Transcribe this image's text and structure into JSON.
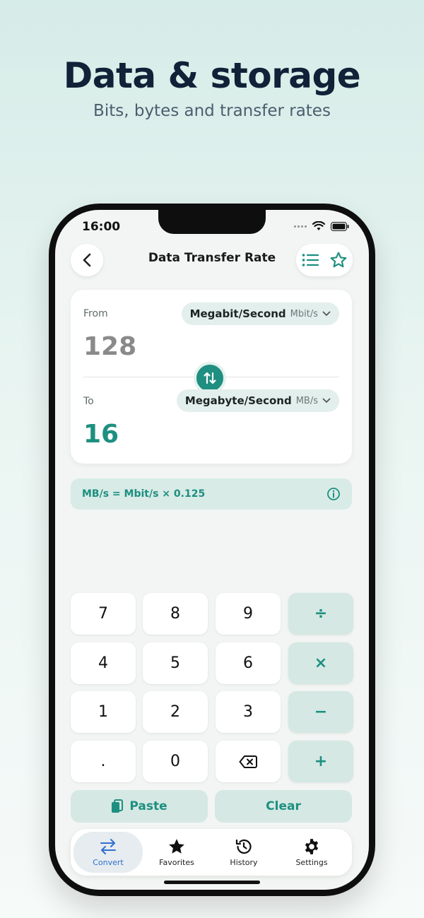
{
  "headline": "Data & storage",
  "subheadline": "Bits, bytes and transfer rates",
  "status": {
    "time": "16:00"
  },
  "nav": {
    "title": "Data Transfer Rate",
    "back_icon": "chevron-left-icon",
    "list_icon": "list-icon",
    "favorite_icon": "star-outline-icon"
  },
  "converter": {
    "from_label": "From",
    "from_unit": "Megabit/Second",
    "from_abbr": "Mbit/s",
    "from_value": "128",
    "to_label": "To",
    "to_unit": "Megabyte/Second",
    "to_abbr": "MB/s",
    "to_value": "16"
  },
  "formula": "MB/s = Mbit/s × 0.125",
  "keypad": {
    "rows": [
      [
        "7",
        "8",
        "9",
        "÷"
      ],
      [
        "4",
        "5",
        "6",
        "×"
      ],
      [
        "1",
        "2",
        "3",
        "−"
      ],
      [
        ".",
        "0",
        "⌫",
        "+"
      ]
    ],
    "paste": "Paste",
    "clear": "Clear"
  },
  "tabs": [
    {
      "label": "Convert",
      "icon": "swap-arrows-icon",
      "active": true
    },
    {
      "label": "Favorites",
      "icon": "star-icon"
    },
    {
      "label": "History",
      "icon": "history-icon"
    },
    {
      "label": "Settings",
      "icon": "gear-icon"
    }
  ],
  "colors": {
    "accent": "#1d8f80",
    "active_tab": "#2f6fd1",
    "headline": "#0f2238"
  }
}
